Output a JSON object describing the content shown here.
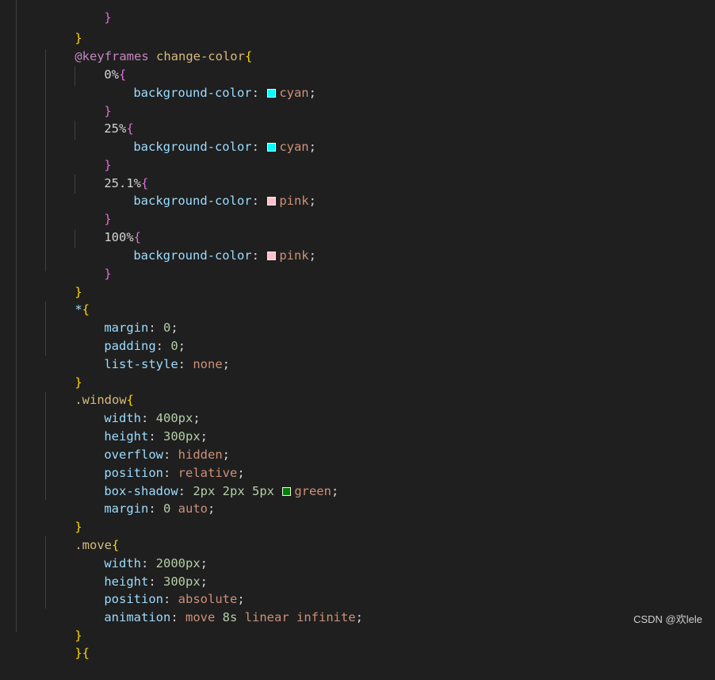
{
  "code": {
    "l1": "}",
    "l2_at": "@keyframes",
    "l2_name": " change-color",
    "l2_brace": "{",
    "kf0": "0%",
    "kf25": "25%",
    "kf251": "25.1%",
    "kf100": "100%",
    "open": "{",
    "close": "}",
    "bg_prop": "background-color",
    "colon": ": ",
    "semi": ";",
    "cyan": "cyan",
    "pink": "pink",
    "star": "*",
    "margin": "margin",
    "padding": "padding",
    "list_style": "list-style",
    "zero": "0",
    "none": "none",
    "window_sel": ".window",
    "width": "width",
    "height": "height",
    "overflow": "overflow",
    "position": "position",
    "box_shadow": "box-shadow",
    "animation": "animation",
    "v400": "400px",
    "v300": "300px",
    "hidden": "hidden",
    "relative": "relative",
    "shadow_nums": "2px 2px 5px ",
    "green": "green",
    "zero_sp": "0 ",
    "auto": "auto",
    "move_sel": ".move",
    "v2000": "2000px",
    "absolute": "absolute",
    "anim_move": "move ",
    "anim_8s": "8s",
    "anim_rest": " linear infinite",
    "tail": "}{"
  },
  "colors": {
    "cyan": "#00ffff",
    "pink": "#ffc0cb",
    "green": "#008000"
  },
  "watermark": "CSDN @欢lele"
}
